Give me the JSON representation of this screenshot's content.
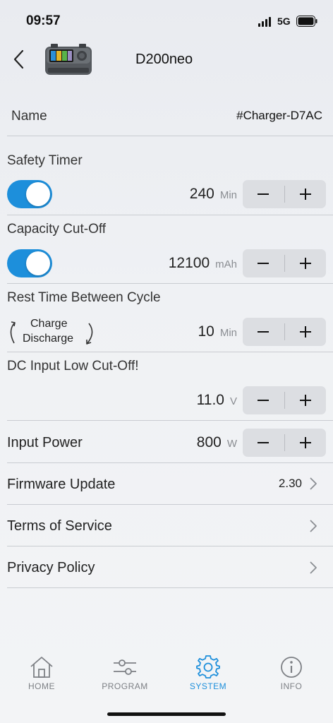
{
  "status_bar": {
    "time": "09:57",
    "network": "5G"
  },
  "header": {
    "title": "D200neo"
  },
  "name_row": {
    "label": "Name",
    "value": "#Charger-D7AC"
  },
  "safety_timer": {
    "title": "Safety Timer",
    "enabled": true,
    "value": "240",
    "unit": "Min"
  },
  "capacity_cutoff": {
    "title": "Capacity Cut-Off",
    "enabled": true,
    "value": "12100",
    "unit": "mAh"
  },
  "rest_time": {
    "title": "Rest Time Between Cycle",
    "cycle_line1": "Charge",
    "cycle_line2": "Discharge",
    "value": "10",
    "unit": "Min"
  },
  "dc_input": {
    "title": "DC Input Low Cut-Off!",
    "value": "11.0",
    "unit": "V"
  },
  "input_power": {
    "title": "Input Power",
    "value": "800",
    "unit": "W"
  },
  "menu": {
    "firmware": {
      "label": "Firmware Update",
      "value": "2.30"
    },
    "terms": {
      "label": "Terms of Service"
    },
    "privacy": {
      "label": "Privacy Policy"
    }
  },
  "tabs": [
    {
      "label": "HOME",
      "icon": "home-icon",
      "active": false
    },
    {
      "label": "PROGRAM",
      "icon": "sliders-icon",
      "active": false
    },
    {
      "label": "SYSTEM",
      "icon": "gear-icon",
      "active": true
    },
    {
      "label": "INFO",
      "icon": "info-icon",
      "active": false
    }
  ],
  "colors": {
    "accent": "#1d8fdb",
    "inactive_tab": "#7d8085",
    "text": "#222222"
  }
}
